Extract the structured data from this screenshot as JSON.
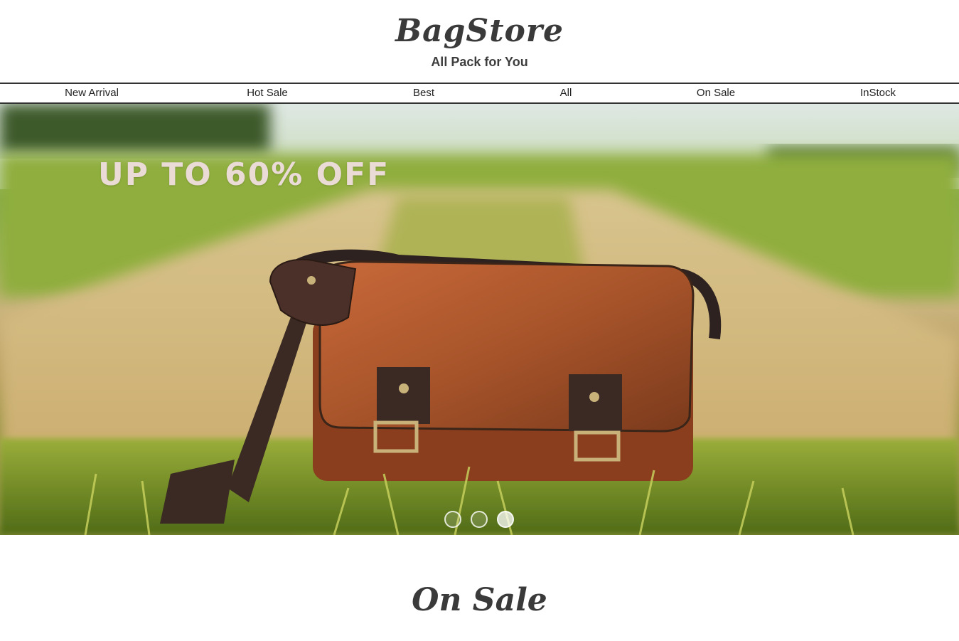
{
  "header": {
    "brand": "BagStore",
    "tagline": "All Pack for You"
  },
  "nav": {
    "items": [
      {
        "label": "New Arrival"
      },
      {
        "label": "Hot Sale"
      },
      {
        "label": "Best"
      },
      {
        "label": "All"
      },
      {
        "label": "On Sale"
      },
      {
        "label": "InStock"
      }
    ]
  },
  "hero": {
    "promo_text": "UP TO 60% OFF",
    "slides_count": 3,
    "active_slide": 3
  },
  "sections": {
    "on_sale_title": "On Sale"
  },
  "colors": {
    "text_dark": "#333333",
    "promo_text": "#eadbd6",
    "leather": "#a8542a",
    "strap": "#3b2a24"
  }
}
